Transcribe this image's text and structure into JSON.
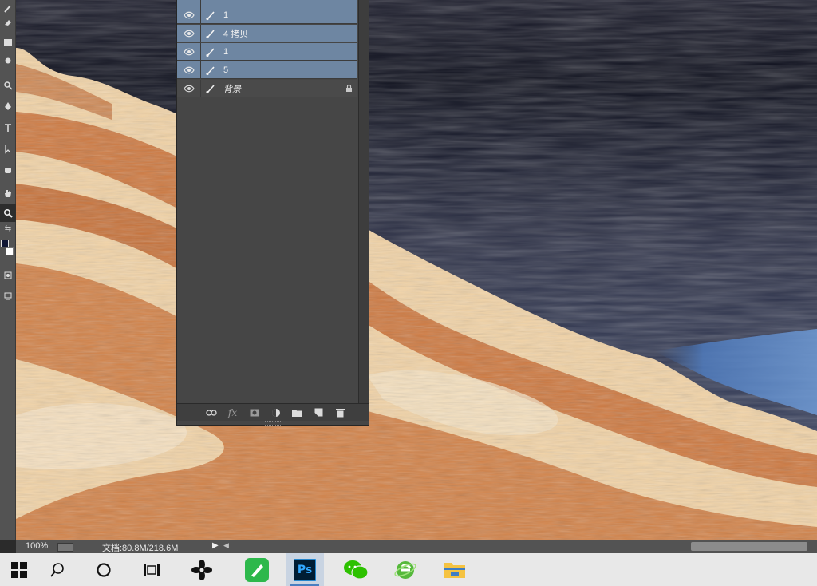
{
  "app": {
    "name": "Photoshop"
  },
  "layers_panel": {
    "layers": [
      {
        "name": "1",
        "selected": true,
        "visible": true
      },
      {
        "name": "4 拷贝",
        "selected": true,
        "visible": true
      },
      {
        "name": "1",
        "selected": true,
        "visible": true
      },
      {
        "name": "5",
        "selected": true,
        "visible": true
      },
      {
        "name": "背景",
        "selected": false,
        "visible": true,
        "locked": true
      }
    ],
    "footer_buttons": [
      "link-layers",
      "fx",
      "add-mask",
      "adjustment",
      "new-group",
      "new-layer",
      "delete"
    ],
    "fx_label": "fx"
  },
  "toolbar": {
    "tools": [
      "brush",
      "eraser",
      "gradient",
      "dodge",
      "pen",
      "type",
      "path-selection",
      "shape",
      "hand",
      "zoom"
    ],
    "foreground_color": "#101634",
    "background_color": "#ffffff"
  },
  "statusbar": {
    "zoom": "100%",
    "doc_info": "文档:80.8M/218.6M"
  },
  "taskbar": {
    "items": [
      "start",
      "search",
      "cortana",
      "task-view",
      "app-petals",
      "app-green-pen",
      "photoshop",
      "wechat",
      "ie-green",
      "file-explorer"
    ],
    "active_item": "photoshop",
    "ps_label": "Ps"
  },
  "colors": {
    "layer_selected": "#6e86a2",
    "panel_bg": "#464646",
    "sand_light": "#f6e4c6",
    "sand_dark": "#c0622a",
    "water_dark": "#232637"
  }
}
